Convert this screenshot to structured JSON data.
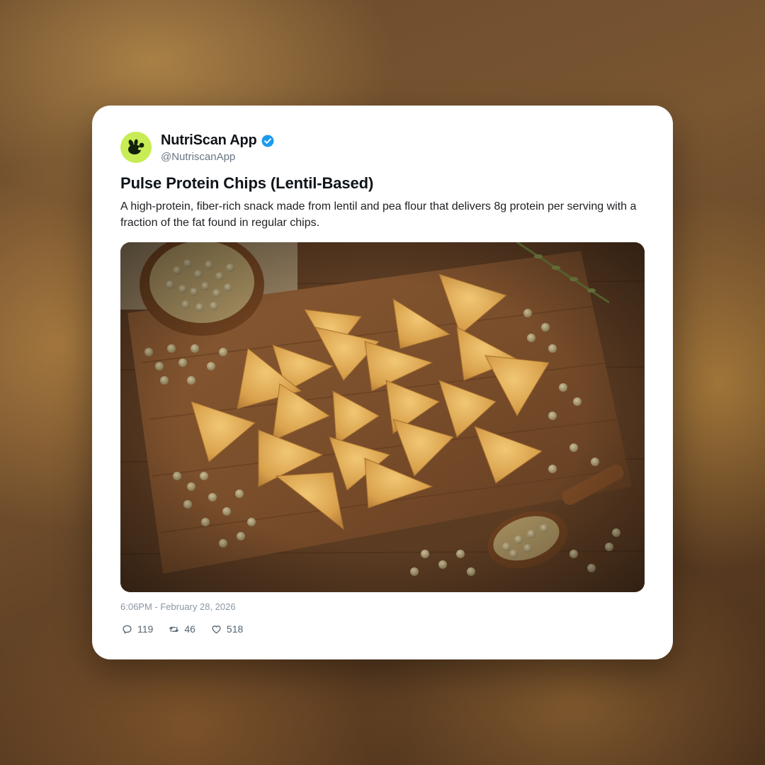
{
  "post": {
    "display_name": "NutriScan App",
    "handle": "@NutriscanApp",
    "verified_icon": "verified-badge-icon",
    "avatar_icon": "leaf-logo-icon",
    "title": "Pulse Protein Chips (Lentil-Based)",
    "description": "A high-protein, fiber-rich snack made from lentil and pea flour that delivers 8g protein per serving with a fraction of the fat found in regular chips.",
    "timestamp": "6:06PM - February 28, 2026",
    "stats": {
      "replies": "119",
      "reposts": "46",
      "likes": "518"
    }
  },
  "colors": {
    "avatar_bg": "#c8ec55",
    "verified": "#1d9bf0",
    "card_bg": "#ffffff"
  }
}
